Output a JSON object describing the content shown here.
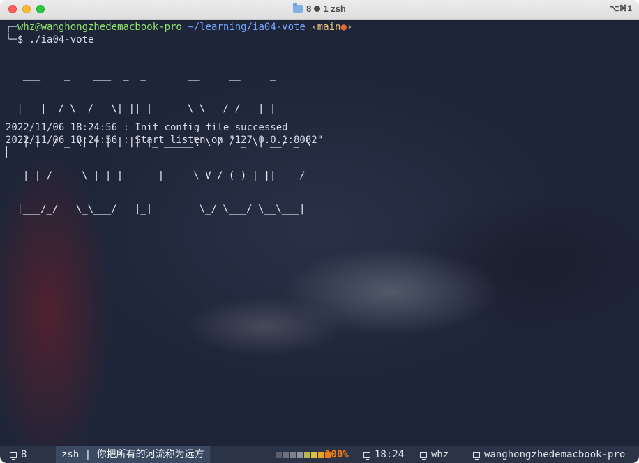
{
  "window": {
    "title": "8 ● 1 zsh",
    "title_tab": "8",
    "title_process": "1 zsh",
    "shortcut": "⌥⌘1"
  },
  "prompt": {
    "user_host": "whz@wanghongzhedemacbook-pro",
    "path": "~/learning/ia04-vote",
    "git_open": "‹",
    "git_branch": "main",
    "git_dirty": "●",
    "git_close": "›",
    "symbol": "$",
    "command": "./ia04-vote"
  },
  "ascii_art": [
    "  ___    _    ___  _  _       __     __     _",
    " |_ _|  / \\  / _ \\| || |      \\ \\   / /__ | |_ ___",
    "  | |  / _ \\| | | | || |_ _____\\ \\ / / _ \\| __/ _ \\",
    "  | | / ___ \\ |_| |__   _|_____\\ V / (_) | ||  __/",
    " |___/_/   \\_\\___/   |_|        \\_/ \\___/ \\__\\___|"
  ],
  "log_lines": [
    "2022/11/06 18:24:56 : Init config file successed",
    "2022/11/06 18:24:56 : Start listen on \"127.0.0.1:8082\""
  ],
  "statusbar": {
    "window_index": "8",
    "window_title": "zsh | 你把所有的河流称为远方",
    "battery_percent": "100%",
    "battery_level": 1.0,
    "meter_colors": [
      "#5a5f6b",
      "#6b707c",
      "#7c818d",
      "#8f939e",
      "#b5b852",
      "#d8c23a",
      "#e9a22a",
      "#f07b16"
    ],
    "time": "18:24",
    "user": "whz",
    "host": "wanghongzhedemacbook-pro"
  },
  "colors": {
    "prompt_user": "#8fe36b",
    "prompt_path": "#74a7ff",
    "git_branch": "#e5c47b",
    "git_dirty": "#e06a3c",
    "battery": "#f07b16"
  },
  "icons": [
    "close-icon",
    "minimize-icon",
    "zoom-icon",
    "folder-icon",
    "monitor-icon"
  ]
}
